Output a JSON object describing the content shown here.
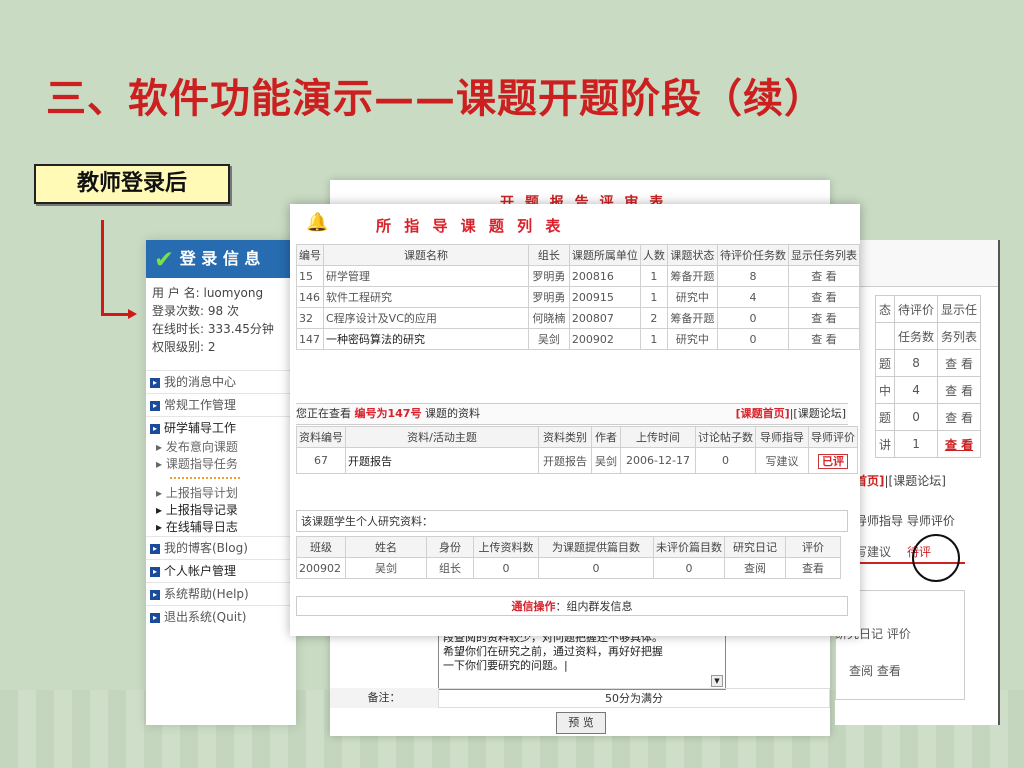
{
  "slide": {
    "title": "三、软件功能演示——课题开题阶段（续）",
    "label": "教师登录后"
  },
  "login_panel": {
    "header": "登 录 信 息",
    "lines": [
      "用 户 名: luomyong",
      "登录次数: 98 次",
      "在线时长: 333.45分钟",
      "权限级别: 2"
    ],
    "menu": [
      {
        "label": "我的消息中心"
      },
      {
        "label": "常规工作管理"
      },
      {
        "label": "研学辅导工作"
      }
    ],
    "submenu_a": [
      "发布意向课题",
      "课题指导任务"
    ],
    "submenu_b": [
      "上报指导计划",
      "上报指导记录",
      "在线辅导日志"
    ],
    "menu2": [
      "我的博客(Blog)",
      "个人帐户管理",
      "系统帮助(Help)",
      "退出系统(Quit)"
    ]
  },
  "form_panel": {
    "title": "开 题 报 告 评 审 表",
    "textarea_lines": [
      "段查阅的资料较少，对问题把握还不够具体。",
      "希望你们在研究之前，通过资料，再好好把握",
      "一下你们要研究的问题。|"
    ],
    "note_label": "备注：",
    "note_value": "50分为满分",
    "preview_button": "预 览"
  },
  "right_panel": {
    "cols": [
      "态",
      "待评价",
      "显示任",
      "",
      "任务数",
      "务列表"
    ],
    "rows": [
      {
        "a": "题",
        "b": "8",
        "c": "查 看"
      },
      {
        "a": "中",
        "b": "4",
        "c": "查 看"
      },
      {
        "a": "题",
        "b": "0",
        "c": "查 看"
      },
      {
        "a": "讲",
        "b": "1",
        "c": "查 看"
      }
    ],
    "links_red": "首页]",
    "links_rest": "|[课题论坛]",
    "col_labels": "导师指导 导师评价",
    "row_left": "写建议",
    "row_right": "待评",
    "log_label": "研究日记 评价",
    "log_values": "查阅 查看"
  },
  "front_panel": {
    "heading": "所 指 导 课 题 列 表",
    "topics_header": [
      "编号",
      "课题名称",
      "组长",
      "课题所属单位",
      "人数",
      "课题状态",
      "待评价任务数",
      "显示任务列表"
    ],
    "topics": [
      {
        "id": "15",
        "name": "研学管理",
        "leader": "罗明勇",
        "unit": "200816",
        "count": "1",
        "status": "筹备开题",
        "pending": "8",
        "action": "查 看"
      },
      {
        "id": "146",
        "name": "软件工程研究",
        "leader": "罗明勇",
        "unit": "200915",
        "count": "1",
        "status": "研究中",
        "pending": "4",
        "action": "查 看"
      },
      {
        "id": "32",
        "name": "C程序设计及VC的应用",
        "leader": "何晓楠",
        "unit": "200807",
        "count": "2",
        "status": "筹备开题",
        "pending": "0",
        "action": "查 看"
      },
      {
        "id": "147",
        "name": "一种密码算法的研究",
        "leader": "吴剑",
        "unit": "200902",
        "count": "1",
        "status": "研究中",
        "pending": "0",
        "action": "查 看"
      }
    ],
    "viewing_prefix": "您正在查看",
    "viewing_topic": "编号为147号",
    "viewing_suffix": "课题的资料",
    "home_link": "[课题首页]",
    "forum_link": "|[课题论坛]",
    "materials_header": [
      "资料编号",
      "资料/活动主题",
      "资料类别",
      "作者",
      "上传时间",
      "讨论帖子数",
      "导师指导",
      "导师评价"
    ],
    "materials": [
      {
        "id": "67",
        "topic": "开题报告",
        "type": "开题报告",
        "author": "吴剑",
        "date": "2006-12-17",
        "posts": "0",
        "guide": "写建议",
        "review": "已评"
      }
    ],
    "student_section": "该课题学生个人研究资料：",
    "students_header": [
      "班级",
      "姓名",
      "身份",
      "上传资料数",
      "为课题提供篇目数",
      "未评价篇目数",
      "研究日记",
      "评价"
    ],
    "students": [
      {
        "class": "200902",
        "name": "吴剑",
        "role": "组长",
        "uploads": "0",
        "provided": "0",
        "unreviewed": "0",
        "diary": "查阅",
        "review": "查看"
      }
    ],
    "comm_label": "通信操作",
    "comm_text": "：组内群发信息"
  },
  "colors": {
    "accent_red": "#cc1f1f",
    "nav_blue": "#276bb0",
    "label_yellow": "#fffbb7"
  }
}
